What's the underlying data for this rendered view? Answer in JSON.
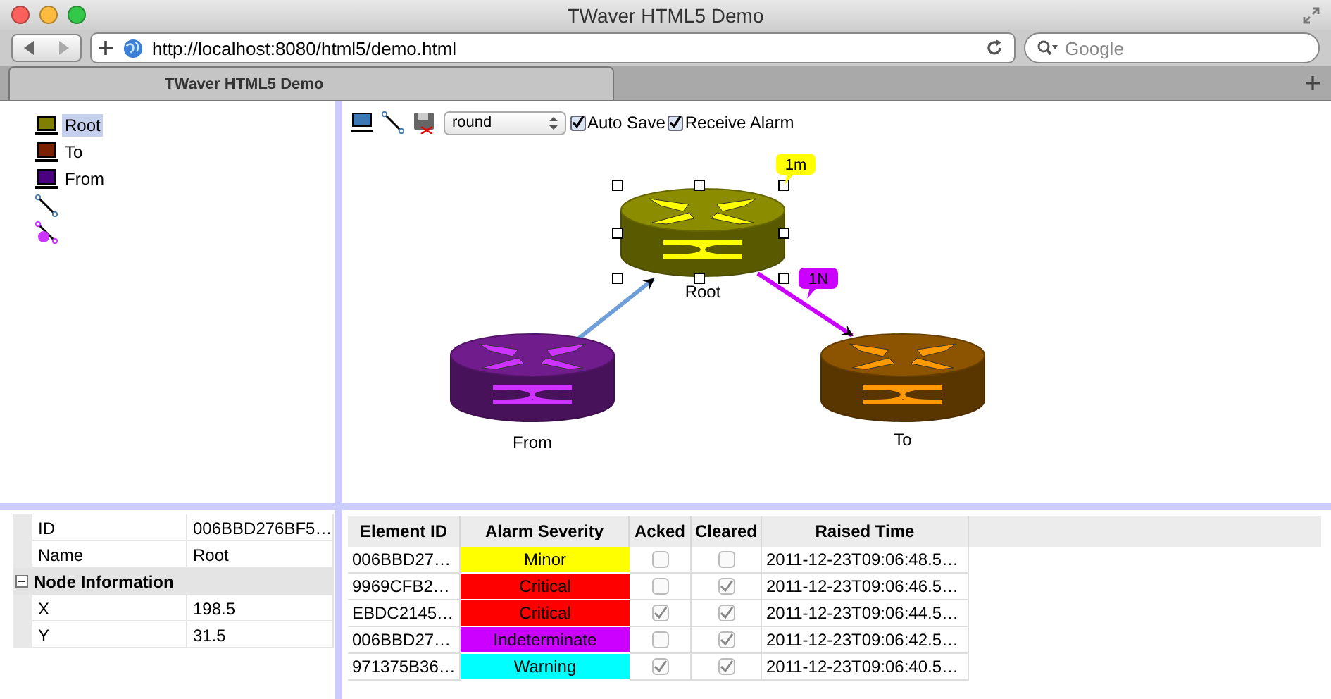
{
  "window": {
    "title": "TWaver HTML5 Demo"
  },
  "browser": {
    "url": "http://localhost:8080/html5/demo.html",
    "search_placeholder": "Google",
    "tabs": [
      {
        "label": "TWaver HTML5 Demo",
        "selected": true
      }
    ]
  },
  "tree": {
    "items": [
      {
        "kind": "node",
        "label": "Root",
        "color": "#808000",
        "selected": true
      },
      {
        "kind": "node",
        "label": "To",
        "color": "#7a2200",
        "selected": false
      },
      {
        "kind": "node",
        "label": "From",
        "color": "#4b0080",
        "selected": false
      },
      {
        "kind": "link",
        "color": "#4a7fb0",
        "selected": false
      },
      {
        "kind": "link",
        "color": "#cc33ff",
        "selected": false
      }
    ]
  },
  "toolbar": {
    "layout": "round",
    "checkboxes": [
      {
        "label": "Auto Save",
        "checked": true
      },
      {
        "label": "Receive Alarm",
        "checked": true
      }
    ]
  },
  "diagram": {
    "nodes": [
      {
        "name": "Root",
        "color": "#ffff00",
        "selected": true,
        "alarm": {
          "label": "1m",
          "color": "#ffff00"
        }
      },
      {
        "name": "From",
        "color": "#cc33ff",
        "selected": false
      },
      {
        "name": "To",
        "color": "#ff9900",
        "selected": false
      }
    ],
    "links": [
      {
        "color": "#6f9fd8"
      },
      {
        "color": "#cc00ff",
        "alarm": {
          "label": "1N",
          "color": "#cc00ff"
        }
      }
    ]
  },
  "properties": {
    "rows": [
      {
        "kind": "property",
        "name": "ID",
        "value": "006BBD276BF5…"
      },
      {
        "kind": "property",
        "name": "Name",
        "value": "Root"
      },
      {
        "kind": "group",
        "name": "Node Information",
        "expanded": true
      },
      {
        "kind": "property",
        "name": "X",
        "value": "198.5"
      },
      {
        "kind": "property",
        "name": "Y",
        "value": "31.5"
      }
    ]
  },
  "alarms": {
    "columns": [
      "Element ID",
      "Alarm Severity",
      "Acked",
      "Cleared",
      "Raised Time"
    ],
    "rows": [
      {
        "element_id": "006BBD27…",
        "severity": "Minor",
        "color": "#ffff00",
        "acked": false,
        "cleared": false,
        "raised_time": "2011-12-23T09:06:48.5…"
      },
      {
        "element_id": "9969CFB2…",
        "severity": "Critical",
        "color": "#ff0000",
        "acked": false,
        "cleared": true,
        "raised_time": "2011-12-23T09:06:46.5…"
      },
      {
        "element_id": "EBDC2145…",
        "severity": "Critical",
        "color": "#ff0000",
        "acked": true,
        "cleared": true,
        "raised_time": "2011-12-23T09:06:44.5…"
      },
      {
        "element_id": "006BBD27…",
        "severity": "Indeterminate",
        "color": "#cc00ff",
        "acked": false,
        "cleared": true,
        "raised_time": "2011-12-23T09:06:42.5…"
      },
      {
        "element_id": "971375B36…",
        "severity": "Warning",
        "color": "#00ffff",
        "acked": true,
        "cleared": true,
        "raised_time": "2011-12-23T09:06:40.5…"
      }
    ]
  }
}
